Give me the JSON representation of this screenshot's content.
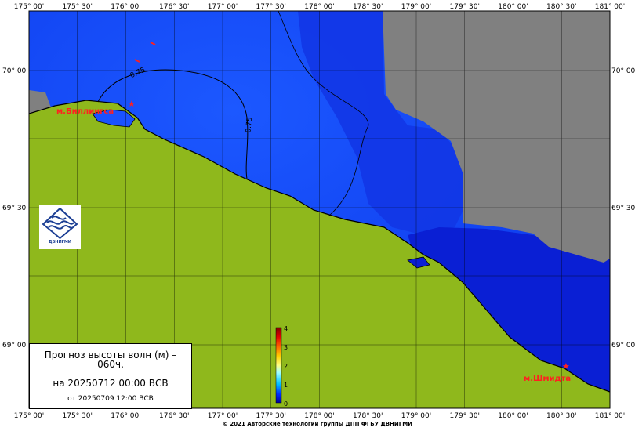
{
  "map": {
    "lon_ticks": [
      "175° 00'",
      "175° 30'",
      "176° 00'",
      "176° 30'",
      "177° 00'",
      "177° 30'",
      "178° 00'",
      "178° 30'",
      "179° 00'",
      "179° 30'",
      "180° 00'",
      "180° 30'",
      "181° 00'"
    ],
    "lat_ticks_left": [
      "70° 00'",
      "69° 30'",
      "69° 00'"
    ],
    "lat_ticks_right": [
      "70° 00'",
      "69° 30'",
      "69° 00'"
    ],
    "places": [
      {
        "name": "м.Биллингса",
        "lon": 176.03,
        "lat": 69.88
      },
      {
        "name": "м.Шмидта",
        "lon": 180.65,
        "lat": 68.92
      }
    ],
    "contour_labels": [
      "0.75",
      "0.75"
    ],
    "colors": {
      "land": "#8fb81c",
      "no_data": "#808080",
      "sea_deep": "#0a1fd4",
      "sea_mid": "#1240ee",
      "sea_light": "#1a52ff",
      "marker": "#ff2020"
    }
  },
  "title": {
    "line1": "Прогноз высоты волн (м) – 060ч.",
    "line2": "на 20250712 00:00 ВСВ",
    "line3": "от 20250709 12:00 ВСВ"
  },
  "colorbar": {
    "unit": "м",
    "ticks": [
      "0",
      "1",
      "2",
      "3",
      "4"
    ],
    "min": 0,
    "max": 4
  },
  "logo": {
    "icon": "dvnigmi-logo-icon",
    "text": "ДВНИГМИ"
  },
  "footer": {
    "copyright": "© 2021 Авторские технологии группы ДПП ФГБУ ДВНИГМИ"
  }
}
